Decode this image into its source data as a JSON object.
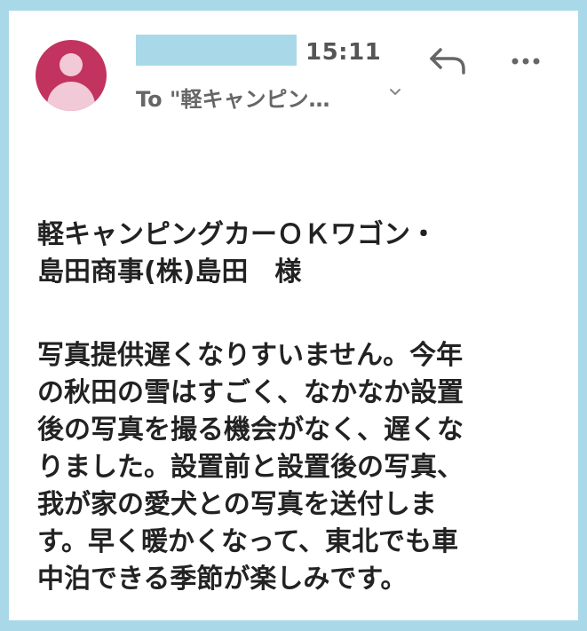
{
  "header": {
    "time": "15:11",
    "to_line": "To \"軽キャンピン…"
  },
  "icons": {
    "avatar": "person-avatar",
    "chevron": "chevron-down-icon",
    "reply": "reply-icon",
    "more": "more-horizontal-icon"
  },
  "colors": {
    "avatar_bg": "#c2335f",
    "redaction": "#a9d9e8"
  },
  "message": {
    "salutation": "軽キャンピングカーＯＫワゴン・\n島田商事(株)島田　様",
    "body": "写真提供遅くなりすいません。今年\nの秋田の雪はすごく、なかなか設置\n後の写真を撮る機会がなく、遅くな\nりました。設置前と設置後の写真、\n我が家の愛犬との写真を送付しま\nす。早く暖かくなって、東北でも車\n中泊できる季節が楽しみです。"
  }
}
